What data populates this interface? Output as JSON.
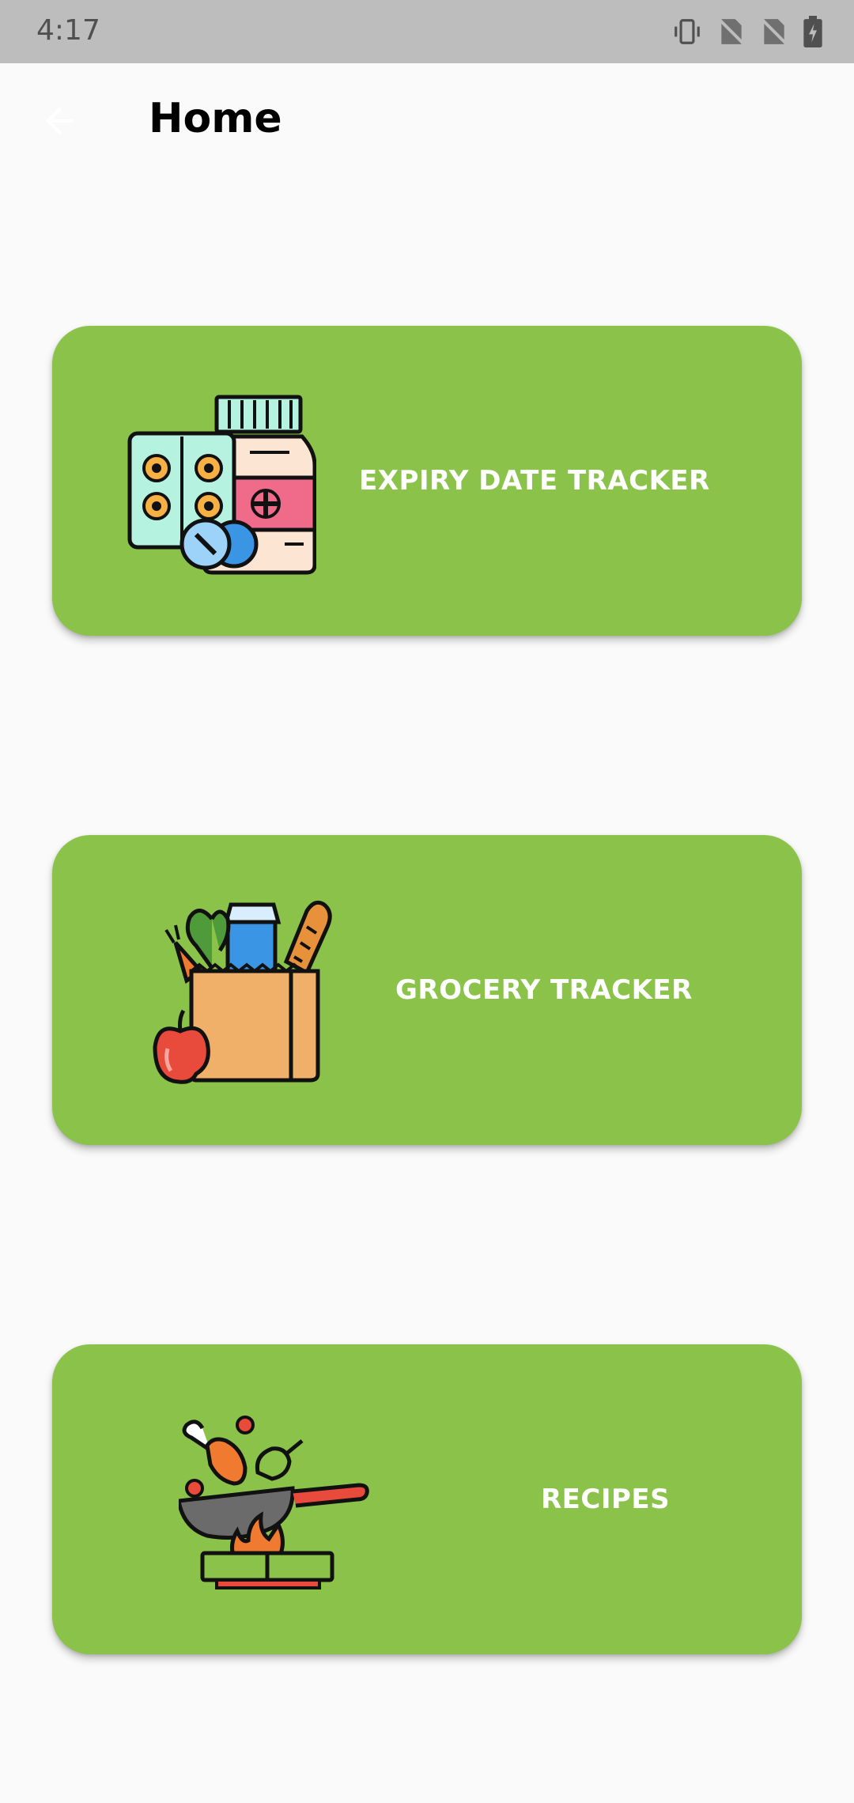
{
  "status_bar": {
    "time": "4:17",
    "icons": [
      "vibrate-icon",
      "no-sim-icon",
      "no-sim-icon",
      "battery-charging-icon"
    ]
  },
  "appbar": {
    "title": "Home",
    "back_icon": "arrow-back-icon"
  },
  "cards": [
    {
      "label": "EXPIRY DATE TRACKER",
      "icon": "medicine-icon"
    },
    {
      "label": "GROCERY TRACKER",
      "icon": "grocery-bag-icon"
    },
    {
      "label": "RECIPES",
      "icon": "cooking-pan-icon"
    }
  ],
  "colors": {
    "card_background": "#8bc34a",
    "page_background": "#fafafa",
    "status_bar": "#bdbdbd",
    "card_text": "#ffffff"
  }
}
